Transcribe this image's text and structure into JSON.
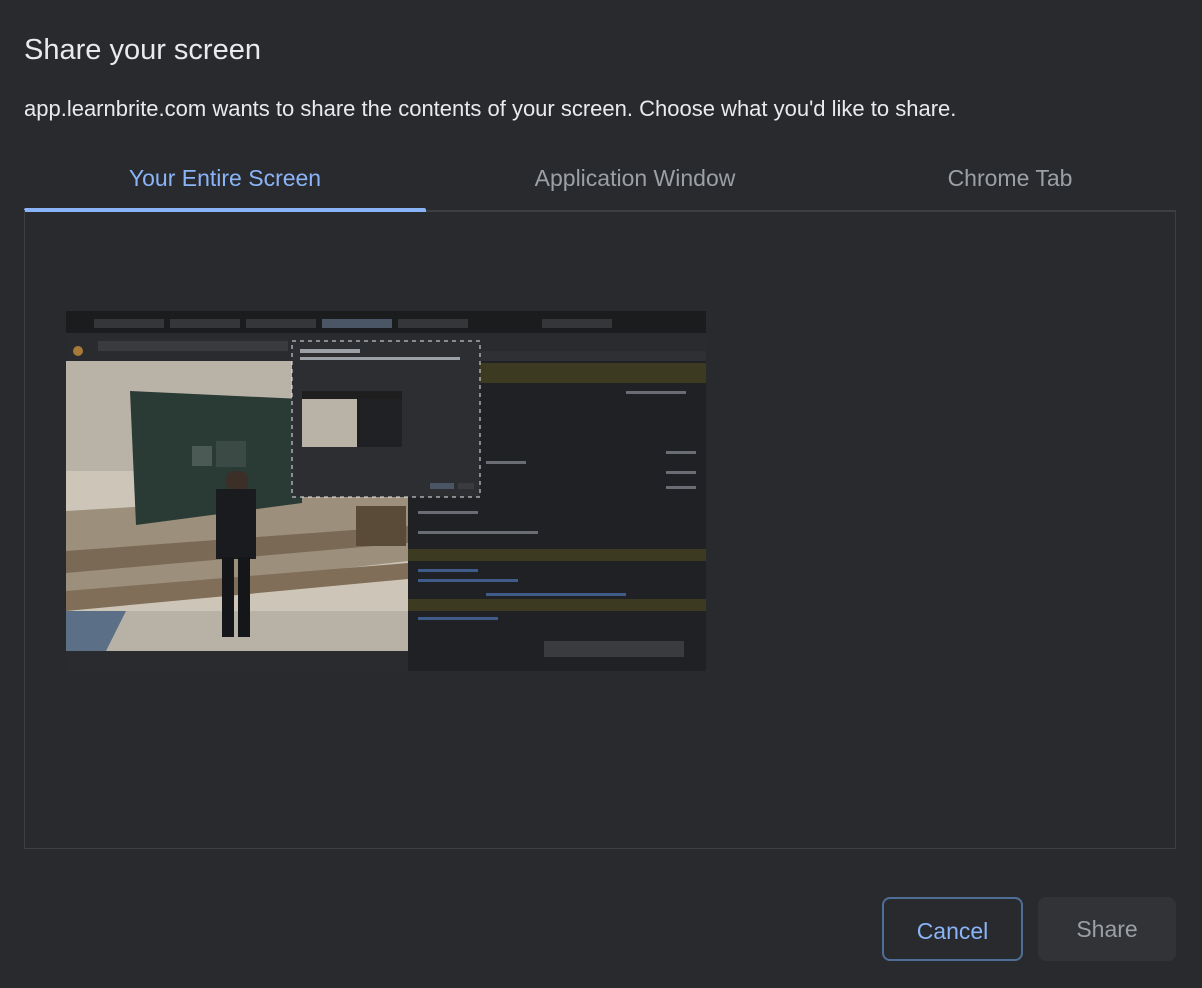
{
  "dialog": {
    "title": "Share your screen",
    "subtitle": "app.learnbrite.com wants to share the contents of your screen. Choose what you'd like to share."
  },
  "tabs": [
    {
      "label": "Your Entire Screen",
      "active": true
    },
    {
      "label": "Application Window",
      "active": false
    },
    {
      "label": "Chrome Tab",
      "active": false
    }
  ],
  "buttons": {
    "cancel_label": "Cancel",
    "share_label": "Share"
  },
  "colors": {
    "background": "#292a2d",
    "accent": "#8ab4f8",
    "text": "#e8eaed",
    "muted": "#9aa0a6"
  }
}
